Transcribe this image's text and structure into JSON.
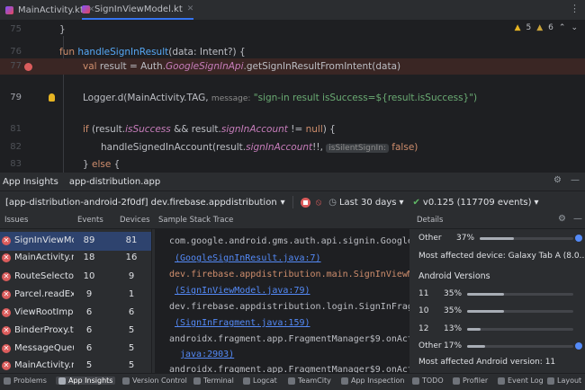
{
  "tabs": [
    {
      "label": "MainActivity.kt",
      "active": false
    },
    {
      "label": "SignInViewModel.kt",
      "active": true
    }
  ],
  "editor": {
    "inspection_warnings": "5",
    "inspection_weak": "6",
    "lines": [
      {
        "num": "75",
        "text": "}"
      },
      {
        "num": "76",
        "text": "fun handleSignInResult(data: Intent?) {"
      },
      {
        "num": "77",
        "text": "val result = Auth.GoogleSignInApi.getSignInResultFromIntent(data)"
      },
      {
        "num": "78",
        "text": ""
      },
      {
        "num": "79",
        "text": "Logger.d(MainActivity.TAG,"
      },
      {
        "num": "80",
        "text": ""
      },
      {
        "num": "81",
        "text": "if (result.isSuccess && result.signInAccount != null) {"
      },
      {
        "num": "82",
        "text": "handleSignedInAccount(result.signInAccount!!,"
      },
      {
        "num": "83",
        "text": "} else {"
      }
    ],
    "hint_message": "message:",
    "log_string": "\"sign-in result isSuccess=${result.isSuccess}\")",
    "hint_silent": "isSilentSignIn:",
    "arg_false": "false)"
  },
  "panel": {
    "title": "App Insights",
    "subtitle": "app-distribution.app"
  },
  "toolbar": {
    "project": "[app-distribution-android-2f0df] dev.firebase.appdistribution",
    "time_range": "Last 30 days",
    "version": "v0.125 (117709 events)"
  },
  "columns": {
    "issues": "Issues",
    "events": "Events",
    "devices": "Devices",
    "stack": "Sample Stack Trace",
    "details": "Details"
  },
  "issues": [
    {
      "name": "SignInViewMod",
      "events": "89",
      "devices": "81",
      "selected": true
    },
    {
      "name": "MainActivity.na",
      "events": "18",
      "devices": "16",
      "selected": false
    },
    {
      "name": "RouteSelector.n",
      "events": "10",
      "devices": "9",
      "selected": false
    },
    {
      "name": "Parcel.readExc",
      "events": "9",
      "devices": "1",
      "selected": false
    },
    {
      "name": "ViewRootImpl.s",
      "events": "6",
      "devices": "6",
      "selected": false
    },
    {
      "name": "BinderProxy.tra",
      "events": "6",
      "devices": "5",
      "selected": false
    },
    {
      "name": "MessageQueue",
      "events": "6",
      "devices": "5",
      "selected": false
    },
    {
      "name": "MainActivity.na",
      "events": "5",
      "devices": "5",
      "selected": false
    }
  ],
  "stack": {
    "l1": "com.google.android.gms.auth.api.signin.GoogleSignI",
    "l2": "(GoogleSignInResult.java:7)",
    "l3": "dev.firebase.appdistribution.main.SignInViewModel.",
    "l4": "(SignInViewModel.java:79)",
    "l5": "dev.firebase.appdistribution.login.SignInFragment.",
    "l6": "(SignInFragment.java:159)",
    "l7": "androidx.fragment.app.FragmentManager$9.onActivity",
    "l8": "java:2903)",
    "l9": "androidx.fragment.app.FragmentManager$9.onActivity"
  },
  "details": {
    "other_top": {
      "label": "Other",
      "pct": "37%",
      "value": 0.37
    },
    "most_device": "Most affected device: Galaxy Tab A (8.0...",
    "versions_title": "Android Versions",
    "versions": [
      {
        "label": "11",
        "pct": "35%",
        "value": 0.35
      },
      {
        "label": "10",
        "pct": "35%",
        "value": 0.35
      },
      {
        "label": "12",
        "pct": "13%",
        "value": 0.13
      },
      {
        "label": "Other",
        "pct": "17%",
        "value": 0.17
      }
    ],
    "most_version": "Most affected Android version: 11"
  },
  "bottombar": [
    {
      "label": "Problems",
      "active": false
    },
    {
      "label": "App Insights",
      "active": true
    },
    {
      "label": "Version Control",
      "active": false
    },
    {
      "label": "Terminal",
      "active": false
    },
    {
      "label": "Logcat",
      "active": false
    },
    {
      "label": "TeamCity",
      "active": false
    },
    {
      "label": "App Inspection",
      "active": false
    },
    {
      "label": "TODO",
      "active": false
    },
    {
      "label": "Profiler",
      "active": false
    },
    {
      "label": "Event Log",
      "active": false
    },
    {
      "label": "Layout",
      "active": false
    }
  ],
  "colors": {
    "accent": "#3574f0",
    "error": "#db5c5c",
    "selection": "#2e436e",
    "success": "#5fb865"
  }
}
